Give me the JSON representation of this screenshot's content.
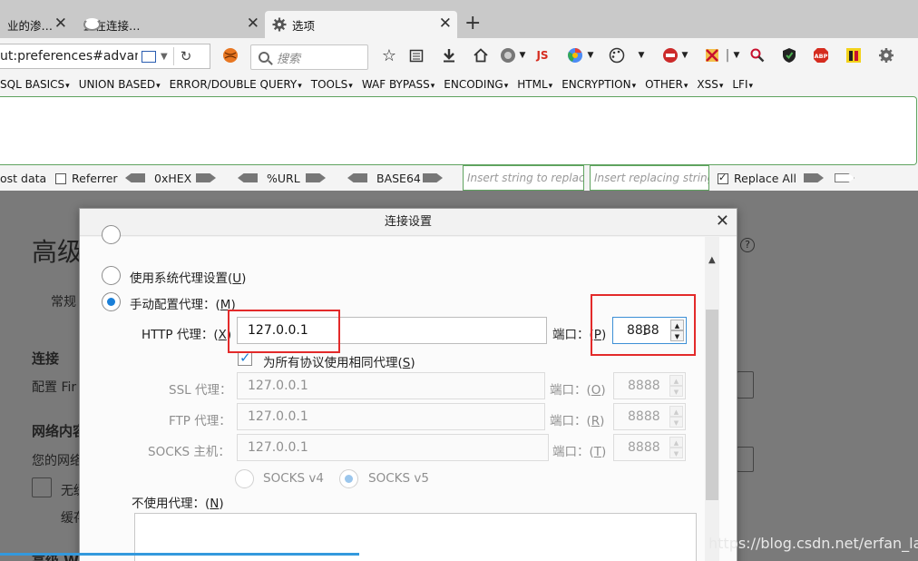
{
  "tabs": [
    {
      "label": "业的渗…",
      "state": "inactive"
    },
    {
      "label": "正在连接…",
      "state": "loading"
    },
    {
      "label": "选项",
      "state": "active"
    }
  ],
  "nav": {
    "url": "ut:preferences#advance",
    "search_placeholder": "搜索",
    "js_label": "JS",
    "abp_label": "ABP"
  },
  "hackbar": {
    "menus": [
      "SQL BASICS",
      "UNION BASED",
      "ERROR/DOUBLE QUERY",
      "TOOLS",
      "WAF BYPASS",
      "ENCODING",
      "HTML",
      "ENCRYPTION",
      "OTHER",
      "XSS",
      "LFI"
    ],
    "post_label": "ost data",
    "referrer_label": "Referrer",
    "hex_label": "0xHEX",
    "url_label": "%URL",
    "base64_label": "BASE64",
    "insert_placeholder": "Insert string to replace",
    "replacing_placeholder": "Insert replacing string",
    "replace_all_label": "Replace All",
    "replace_all_checked": true
  },
  "background": {
    "title": "高级",
    "tab": "常规",
    "section": "连接",
    "desc": "配置 Fir",
    "network": "网络内容",
    "network_desc": "您的网络",
    "cb_text": "无缓",
    "cb_sub": "缓存",
    "bottom": "高级 W"
  },
  "dialog": {
    "title": "连接设置",
    "system_proxy": "使用系统代理设置",
    "system_proxy_key": "U",
    "manual_proxy": "手动配置代理：",
    "manual_proxy_key": "M",
    "http_label": "HTTP 代理：",
    "http_key": "X",
    "http_value": "127.0.0.1",
    "port_label": "端口：",
    "http_port_key": "P",
    "http_port": "8888",
    "same_proxy": "为所有协议使用相同代理",
    "same_proxy_key": "S",
    "ssl_label": "SSL 代理：",
    "ssl_value": "127.0.0.1",
    "ssl_port_key": "O",
    "ssl_port": "8888",
    "ftp_label": "FTP 代理：",
    "ftp_value": "127.0.0.1",
    "ftp_port_key": "R",
    "ftp_port": "8888",
    "socks_label": "SOCKS 主机：",
    "socks_value": "127.0.0.1",
    "socks_port_key": "T",
    "socks_port": "8888",
    "socks4": "SOCKS v4",
    "socks5": "SOCKS v5",
    "no_proxy": "不使用代理：",
    "no_proxy_key": "N"
  },
  "watermark": "https://blog.csdn.net/erfan_lang",
  "colors": {
    "highlight": "#e32a2a",
    "accent": "#1a7fd8",
    "hackbar_border": "#5fa35f"
  }
}
